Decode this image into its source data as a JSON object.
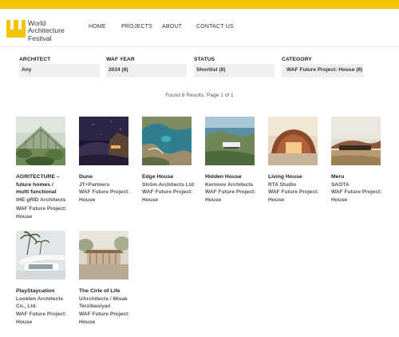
{
  "brand": {
    "name_lines": [
      "World",
      "Architecture",
      "Festival"
    ],
    "color": "#f5c400"
  },
  "nav": {
    "home": "HOME",
    "projects": "PROJECTS",
    "about": "ABOUT",
    "contact": "CONTACT US"
  },
  "filters": {
    "architect": {
      "label": "ARCHITECT",
      "value": "Any"
    },
    "year": {
      "label": "WAF YEAR",
      "value": "2024  (8)"
    },
    "status": {
      "label": "STATUS",
      "value": "Shortlist  (8)"
    },
    "category": {
      "label": "CATEGORY",
      "value": "WAF Future Project: House  (8)"
    }
  },
  "results_text": "Found 8 Results. Page 1 of 1",
  "projects": [
    {
      "title_lines": [
        "AGRITECTURE –",
        "future homes /",
        "multi functional"
      ],
      "architect_lines": [
        "tHE gRID Architects"
      ],
      "category_lines": [
        "WAF Future Project:",
        "House"
      ],
      "image": "greenhouse-image"
    },
    {
      "title_lines": [
        "Dune"
      ],
      "architect_lines": [
        "JT+Partners"
      ],
      "category_lines": [
        "WAF Future Project:",
        "House"
      ],
      "image": "night-desert-image"
    },
    {
      "title_lines": [
        "Edge House"
      ],
      "architect_lines": [
        "Ström Architects Ltd"
      ],
      "category_lines": [
        "WAF Future Project:",
        "House"
      ],
      "image": "coastline-aerial-image"
    },
    {
      "title_lines": [
        "Hidden House"
      ],
      "architect_lines": [
        "Kerimov Architects"
      ],
      "category_lines": [
        "WAF Future Project:",
        "House"
      ],
      "image": "coastal-hill-house-image"
    },
    {
      "title_lines": [
        "Living House"
      ],
      "architect_lines": [
        "RTA Studio"
      ],
      "category_lines": [
        "WAF Future Project:",
        "House"
      ],
      "image": "curved-timber-house-image"
    },
    {
      "title_lines": [
        "Meru"
      ],
      "architect_lines": [
        "SAOTA"
      ],
      "category_lines": [
        "WAF Future Project:",
        "House"
      ],
      "image": "savanna-roof-house-image"
    },
    {
      "title_lines": [
        "PlayStaycation"
      ],
      "architect_lines": [
        "Looklen Architects",
        "Co., Ltd."
      ],
      "category_lines": [
        "WAF Future Project:",
        "House"
      ],
      "image": "white-villa-palms-image"
    },
    {
      "title_lines": [
        "The Cirle of Life"
      ],
      "architect_lines": [
        "UArchitects / Misak",
        "Terzibasiyan"
      ],
      "category_lines": [
        "WAF Future Project:",
        "House"
      ],
      "image": "pavilion-forest-image"
    }
  ]
}
